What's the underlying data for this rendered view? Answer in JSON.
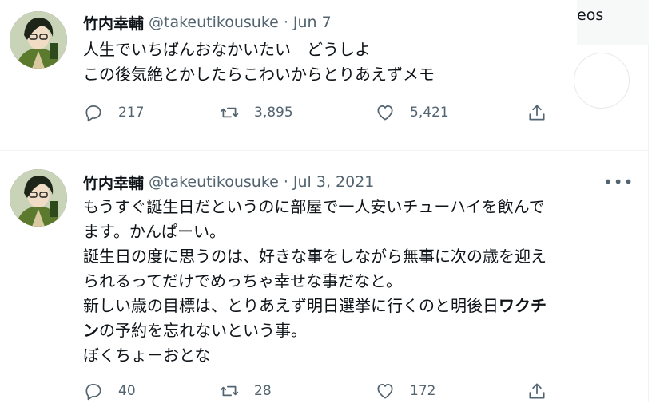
{
  "tweets": [
    {
      "name": "竹内幸輔",
      "handle": "@takeutikousuke",
      "date": "Jun 7",
      "lines": [
        "人生でいちばんおなかいたい　どうしよ",
        "この後気絶とかしたらこわいからとりあえずメモ"
      ],
      "replies": "217",
      "retweets": "3,895",
      "likes": "5,421"
    },
    {
      "name": "竹内幸輔",
      "handle": "@takeutikousuke",
      "date": "Jul 3, 2021",
      "lines": [
        "もうすぐ誕生日だというのに部屋で一人安いチューハイを飲んで",
        "ます。かんぱーい。",
        "誕生日の度に思うのは、好きな事をしながら無事に次の歳を迎え",
        "られるってだけでめっちゃ幸せな事だなと。",
        "新しい歳の目標は、とりあえず明日選挙に行くのと明後日",
        "の予約を忘れないという事。",
        "ぼくちょーおとな"
      ],
      "bold_part1": "ワクチ",
      "bold_part2": "ン",
      "replies": "40",
      "retweets": "28",
      "likes": "172",
      "more": "•••"
    }
  ],
  "overlay": {
    "label": "eos"
  },
  "icons": {
    "reply": "reply-icon",
    "retweet": "retweet-icon",
    "like": "like-icon",
    "share": "share-icon"
  }
}
